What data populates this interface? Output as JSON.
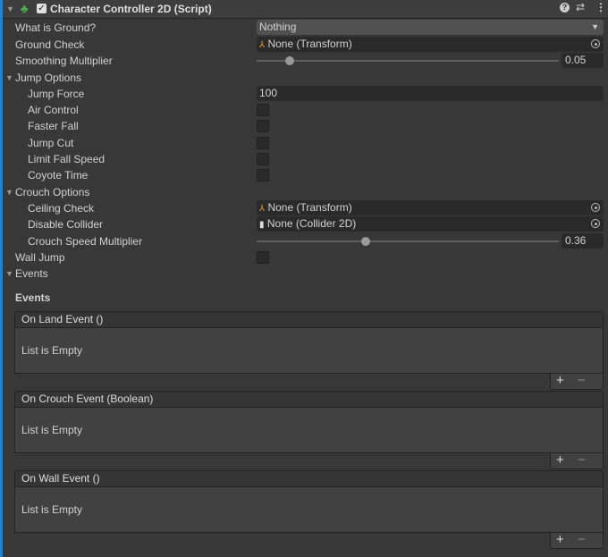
{
  "component": {
    "title": "Character Controller 2D (Script)",
    "enabled": true
  },
  "fields": {
    "what_is_ground": {
      "label": "What is Ground?",
      "value": "Nothing"
    },
    "ground_check": {
      "label": "Ground Check",
      "value": "None (Transform)"
    },
    "smoothing": {
      "label": "Smoothing Multiplier",
      "value": "0.05",
      "fraction": 0.11
    },
    "jump_options": {
      "label": "Jump Options"
    },
    "jump_force": {
      "label": "Jump Force",
      "value": "100"
    },
    "air_control": {
      "label": "Air Control",
      "checked": false
    },
    "faster_fall": {
      "label": "Faster Fall",
      "checked": false
    },
    "jump_cut": {
      "label": "Jump Cut",
      "checked": false
    },
    "limit_fall": {
      "label": "Limit Fall Speed",
      "checked": false
    },
    "coyote": {
      "label": "Coyote Time",
      "checked": false
    },
    "crouch_options": {
      "label": "Crouch Options"
    },
    "ceiling_check": {
      "label": "Ceiling Check",
      "value": "None (Transform)"
    },
    "disable_collider": {
      "label": "Disable Collider",
      "value": "None (Collider 2D)"
    },
    "crouch_speed": {
      "label": "Crouch Speed Multiplier",
      "value": "0.36",
      "fraction": 0.36
    },
    "wall_jump": {
      "label": "Wall Jump",
      "checked": false
    },
    "events_foldout": {
      "label": "Events"
    },
    "events_header": "Events"
  },
  "events": [
    {
      "title": "On Land Event ()",
      "empty": "List is Empty"
    },
    {
      "title": "On Crouch Event (Boolean)",
      "empty": "List is Empty"
    },
    {
      "title": "On Wall Event ()",
      "empty": "List is Empty"
    }
  ],
  "icons": {
    "add": "+",
    "remove": "−"
  }
}
